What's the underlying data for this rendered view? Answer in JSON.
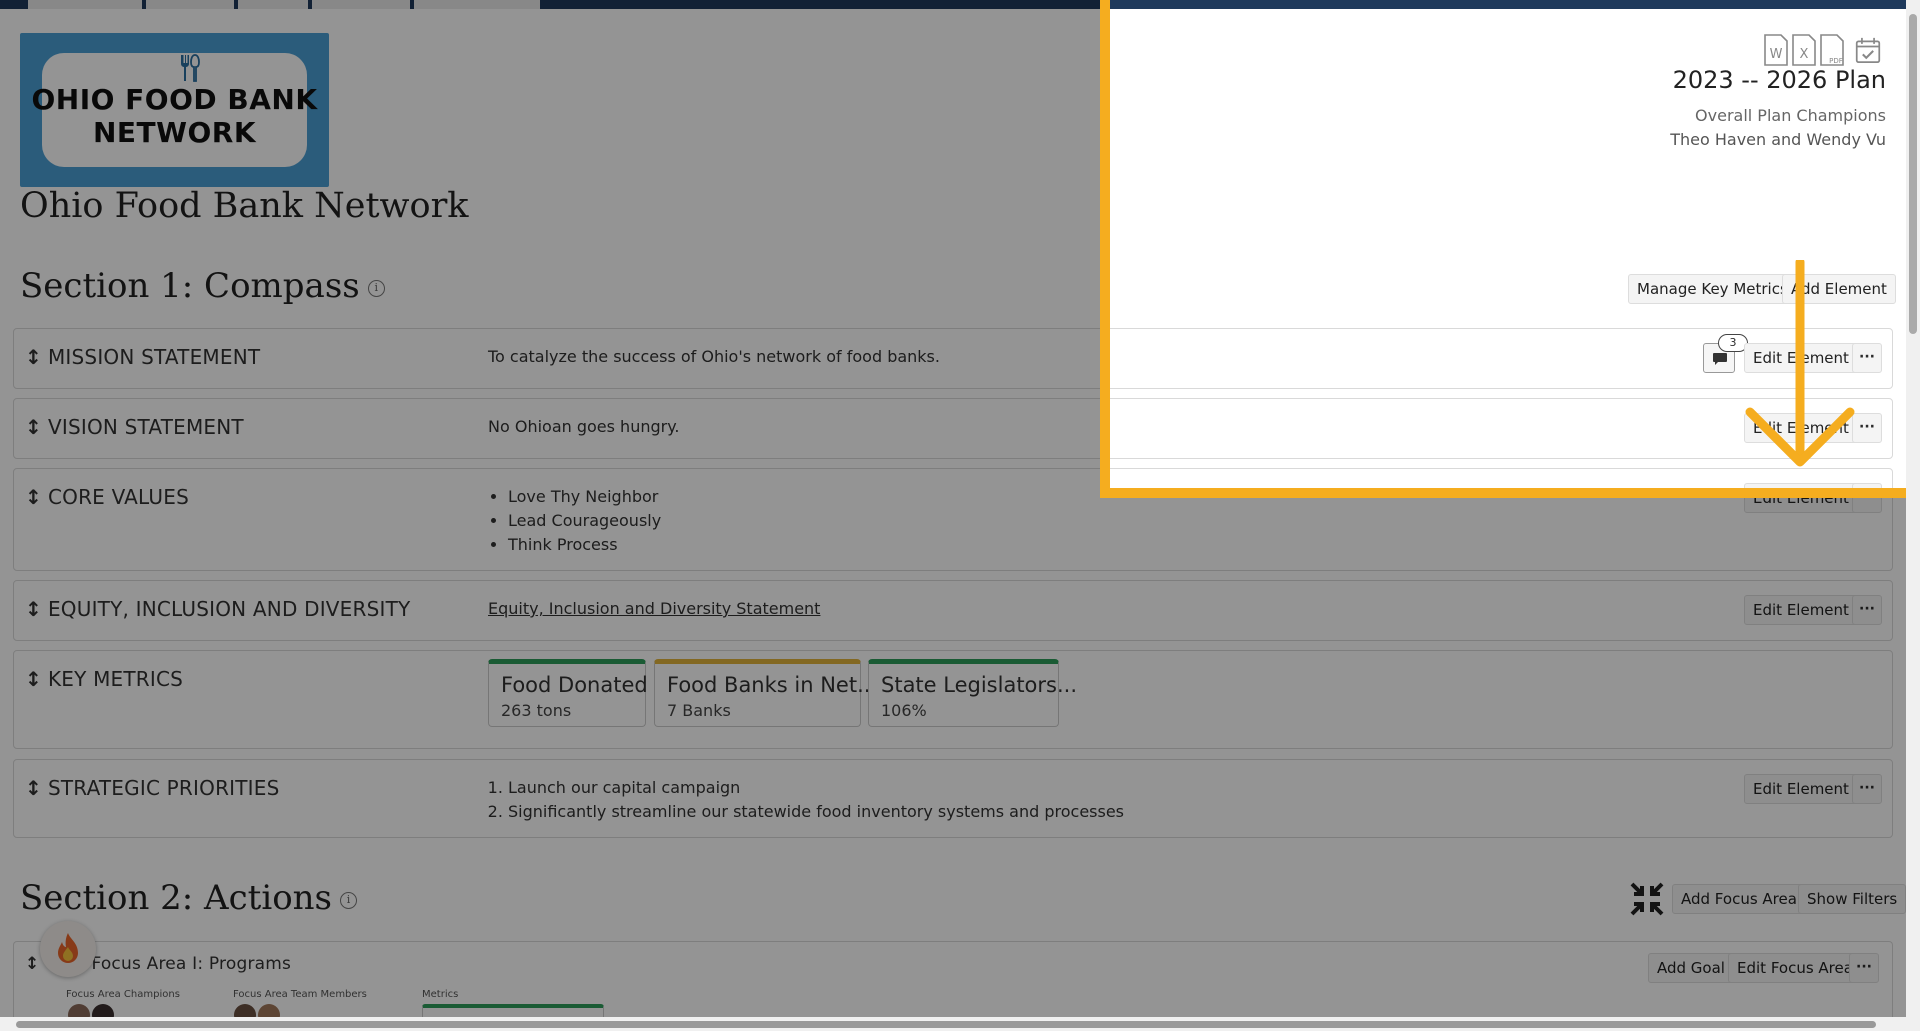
{
  "org": {
    "name": "Ohio Food Bank Network",
    "logo_text_line1": "OHIO FOOD BANK",
    "logo_text_line2": "NETWORK"
  },
  "plan": {
    "title": "2023 -- 2026 Plan",
    "champions_label": "Overall Plan Champions",
    "champions": "Theo Haven and Wendy Vu"
  },
  "export_icons": [
    "word-icon",
    "excel-icon",
    "pdf-icon",
    "calendar-check-icon"
  ],
  "section1": {
    "title": "Section 1: Compass",
    "manage_metrics_label": "Manage Key Metrics",
    "add_element_label": "Add Element",
    "rows": [
      {
        "label": "MISSION STATEMENT",
        "value": "To catalyze the success of Ohio's network of food banks.",
        "comment_count": "3",
        "edit_label": "Edit Element"
      },
      {
        "label": "VISION STATEMENT",
        "value": "No Ohioan goes hungry.",
        "edit_label": "Edit Element"
      },
      {
        "label": "CORE VALUES",
        "items": [
          "Love Thy Neighbor",
          "Lead Courageously",
          "Think Process"
        ],
        "edit_label": "Edit Element"
      },
      {
        "label": "EQUITY, INCLUSION AND DIVERSITY",
        "link": "Equity, Inclusion and Diversity Statement",
        "edit_label": "Edit Element"
      },
      {
        "label": "KEY METRICS",
        "metrics": [
          {
            "name": "Food Donated",
            "value": "263 tons",
            "color": "#2e9e5b"
          },
          {
            "name": "Food Banks in Net...",
            "value": "7 Banks",
            "color": "#e2b43c"
          },
          {
            "name": "State Legislators...",
            "value": "106%",
            "color": "#2e9e5b"
          }
        ]
      },
      {
        "label": "STRATEGIC PRIORITIES",
        "items": [
          "Launch our capital campaign",
          "Significantly streamline our statewide food inventory systems and processes"
        ],
        "edit_label": "Edit Element"
      }
    ]
  },
  "section2": {
    "title": "Section 2: Actions",
    "add_focus_label": "Add Focus Area",
    "show_filters_label": "Show Filters",
    "focus_area": {
      "title": "Focus Area I: Programs",
      "champions_label": "Focus Area Champions",
      "team_label": "Focus Area Team Members",
      "metrics_label": "Metrics",
      "add_goal_label": "Add Goal",
      "edit_label": "Edit Focus Area"
    }
  },
  "more_label": "···"
}
